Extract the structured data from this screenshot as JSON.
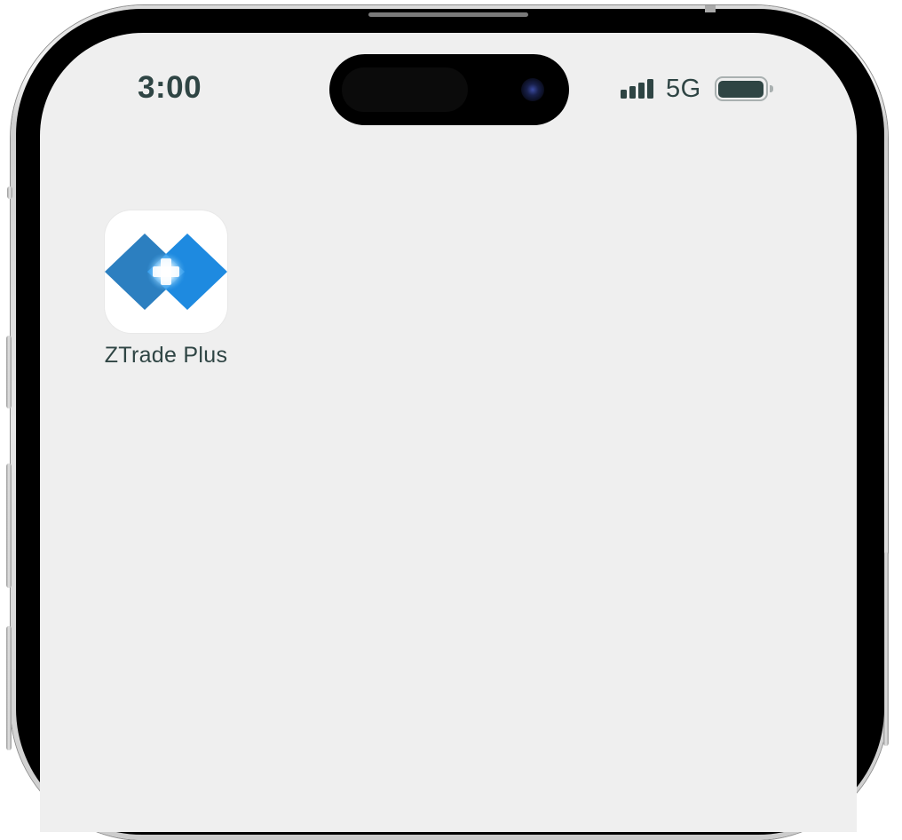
{
  "status_bar": {
    "time": "3:00",
    "network": "5G",
    "signal_icon": "cellular-signal-icon",
    "battery_icon": "battery-icon"
  },
  "home_screen": {
    "apps": [
      {
        "label": "ZTrade Plus",
        "icon": "ztrade-plus-logo",
        "colors": [
          "#2f87c8",
          "#1f8be0",
          "#86c8f5"
        ]
      }
    ]
  },
  "colors": {
    "text": "#2f4544",
    "background": "#efefef"
  }
}
